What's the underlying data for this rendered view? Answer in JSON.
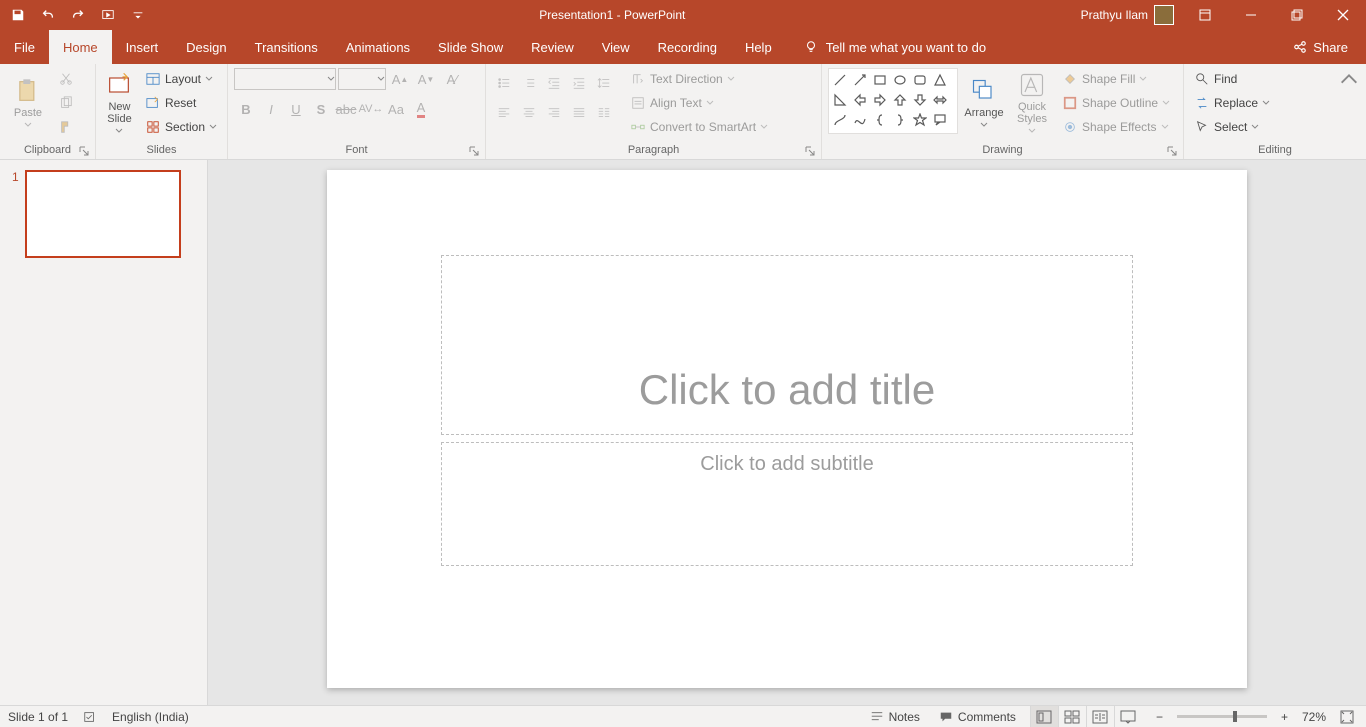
{
  "title": "Presentation1  -  PowerPoint",
  "user": "Prathyu Ilam",
  "tabs": {
    "file": "File",
    "home": "Home",
    "insert": "Insert",
    "design": "Design",
    "transitions": "Transitions",
    "animations": "Animations",
    "slideshow": "Slide Show",
    "review": "Review",
    "view": "View",
    "recording": "Recording",
    "help": "Help"
  },
  "tellme": "Tell me what you want to do",
  "share": "Share",
  "ribbon": {
    "clipboard": {
      "label": "Clipboard",
      "paste": "Paste"
    },
    "slides": {
      "label": "Slides",
      "newSlide": "New\nSlide",
      "layout": "Layout",
      "reset": "Reset",
      "section": "Section"
    },
    "font": {
      "label": "Font"
    },
    "paragraph": {
      "label": "Paragraph",
      "textDirection": "Text Direction",
      "alignText": "Align Text",
      "convertSmartArt": "Convert to SmartArt"
    },
    "drawing": {
      "label": "Drawing",
      "arrange": "Arrange",
      "quickStyles": "Quick\nStyles",
      "shapeFill": "Shape Fill",
      "shapeOutline": "Shape Outline",
      "shapeEffects": "Shape Effects"
    },
    "editing": {
      "label": "Editing",
      "find": "Find",
      "replace": "Replace",
      "select": "Select"
    }
  },
  "thumbnails": {
    "slide1": "1"
  },
  "slide": {
    "titlePlaceholder": "Click to add title",
    "subtitlePlaceholder": "Click to add subtitle"
  },
  "statusbar": {
    "slideOf": "Slide 1 of 1",
    "language": "English (India)",
    "notes": "Notes",
    "comments": "Comments",
    "zoom": "72%"
  }
}
